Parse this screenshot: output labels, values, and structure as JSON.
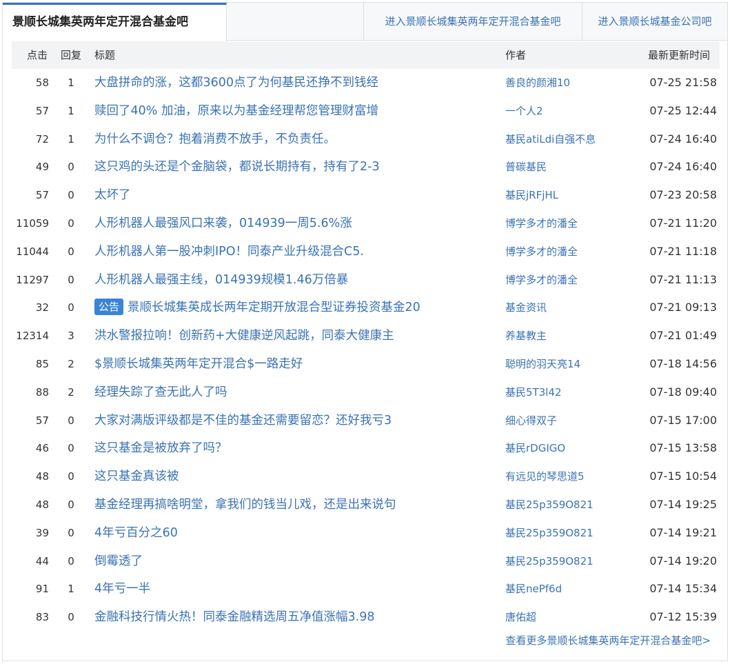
{
  "tabs": {
    "active": "景顺长城集英两年定开混合基金吧",
    "link1": "进入景顺长城集英两年定开混合基金吧",
    "link2": "进入景顺长城基金公司吧"
  },
  "columns": {
    "clicks": "点击",
    "replies": "回复",
    "title": "标题",
    "author": "作者",
    "time": "最新更新时间"
  },
  "rows": [
    {
      "clicks": "58",
      "replies": "1",
      "title": "大盘拼命的涨，这都3600点了为何基民还挣不到钱经",
      "author": "善良的颜湘10",
      "time": "07-25 21:58"
    },
    {
      "clicks": "57",
      "replies": "1",
      "title": "赎回了40% 加油，原来以为基金经理帮您管理财富增",
      "author": "一个人2",
      "time": "07-25 12:44"
    },
    {
      "clicks": "72",
      "replies": "1",
      "title": "为什么不调仓？抱着消费不放手，不负责任。",
      "author": "基民atiLdi自强不息",
      "time": "07-24 16:40"
    },
    {
      "clicks": "49",
      "replies": "0",
      "title": "这只鸡的头还是个金脑袋，都说长期持有，持有了2-3",
      "author": "普碳基民",
      "time": "07-24 16:40"
    },
    {
      "clicks": "57",
      "replies": "0",
      "title": "太坏了",
      "author": "基民jRFjHL",
      "time": "07-23 20:58"
    },
    {
      "clicks": "11059",
      "replies": "0",
      "title": "人形机器人最强风口来袭，014939一周5.6%涨",
      "author": "博学多才的潘全",
      "time": "07-21 11:20"
    },
    {
      "clicks": "11044",
      "replies": "0",
      "title": "人形机器人第一股冲刺IPO！同泰产业升级混合C5.",
      "author": "博学多才的潘全",
      "time": "07-21 11:18"
    },
    {
      "clicks": "11297",
      "replies": "0",
      "title": "人形机器人最强主线，014939规模1.46万倍暴",
      "author": "博学多才的潘全",
      "time": "07-21 11:13"
    },
    {
      "clicks": "32",
      "replies": "0",
      "badge": "公告",
      "title": "景顺长城集英成长两年定期开放混合型证券投资基金20",
      "author": "基金资讯",
      "time": "07-21 09:13"
    },
    {
      "clicks": "12314",
      "replies": "3",
      "title": "洪水警报拉响！创新药+大健康逆风起跳，同泰大健康主",
      "author": "养基教主",
      "time": "07-21 01:49"
    },
    {
      "clicks": "85",
      "replies": "2",
      "title": "$景顺长城集英两年定开混合$一路走好",
      "author": "聪明的羽天亮14",
      "time": "07-18 14:56"
    },
    {
      "clicks": "88",
      "replies": "2",
      "title": "经理失踪了查无此人了吗",
      "author": "基民5T3l42",
      "time": "07-18 09:40"
    },
    {
      "clicks": "57",
      "replies": "0",
      "title": "大家对满版评级都是不佳的基金还需要留恋？还好我亏3",
      "author": "细心得双子",
      "time": "07-15 17:00"
    },
    {
      "clicks": "46",
      "replies": "0",
      "title": "这只基金是被放弃了吗？",
      "author": "基民rDGIGO",
      "time": "07-15 13:58"
    },
    {
      "clicks": "48",
      "replies": "0",
      "title": "这只基金真该被",
      "author": "有远见的琴思道5",
      "time": "07-15 10:54"
    },
    {
      "clicks": "48",
      "replies": "0",
      "title": "基金经理再搞啥明堂，拿我们的钱当儿戏，还是出来说句",
      "author": "基民25p359O821",
      "time": "07-14 19:25"
    },
    {
      "clicks": "39",
      "replies": "0",
      "title": "4年亏百分之60",
      "author": "基民25p359O821",
      "time": "07-14 19:21"
    },
    {
      "clicks": "44",
      "replies": "0",
      "title": "倒霉透了",
      "author": "基民25p359O821",
      "time": "07-14 19:20"
    },
    {
      "clicks": "91",
      "replies": "1",
      "title": "4年亏一半",
      "author": "基民nePf6d",
      "time": "07-14 15:34"
    },
    {
      "clicks": "83",
      "replies": "0",
      "title": "金融科技行情火热！同泰金融精选周五净值涨幅3.98",
      "author": "唐佑超",
      "time": "07-12 15:39"
    }
  ],
  "more_link": "查看更多景顺长城集英两年定开混合基金吧>",
  "colors": {
    "link": "#3a73b4",
    "badge": "#3a84d6",
    "header_bg": "#f2f3f5"
  }
}
